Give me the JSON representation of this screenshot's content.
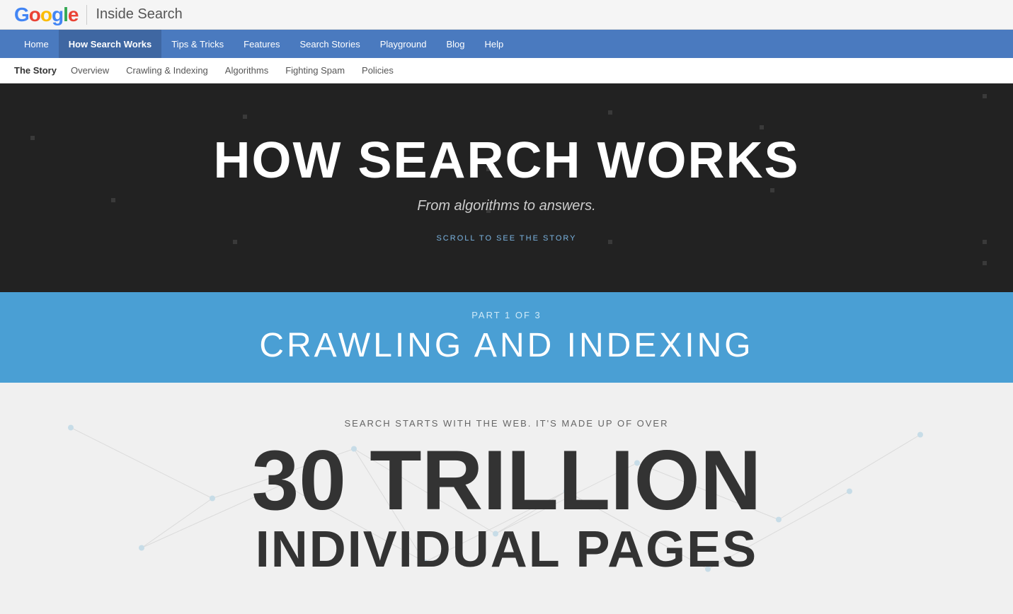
{
  "header": {
    "google_logo": "Google",
    "divider": "|",
    "site_title": "Inside Search"
  },
  "main_nav": {
    "items": [
      {
        "id": "home",
        "label": "Home",
        "active": false
      },
      {
        "id": "how-search-works",
        "label": "How Search Works",
        "active": true
      },
      {
        "id": "tips-tricks",
        "label": "Tips & Tricks",
        "active": false
      },
      {
        "id": "features",
        "label": "Features",
        "active": false
      },
      {
        "id": "search-stories",
        "label": "Search Stories",
        "active": false
      },
      {
        "id": "playground",
        "label": "Playground",
        "active": false
      },
      {
        "id": "blog",
        "label": "Blog",
        "active": false
      },
      {
        "id": "help",
        "label": "Help",
        "active": false
      }
    ]
  },
  "sub_nav": {
    "label": "The Story",
    "items": [
      {
        "id": "overview",
        "label": "Overview",
        "active": false
      },
      {
        "id": "crawling-indexing",
        "label": "Crawling & Indexing",
        "active": false
      },
      {
        "id": "algorithms",
        "label": "Algorithms",
        "active": false
      },
      {
        "id": "fighting-spam",
        "label": "Fighting Spam",
        "active": false
      },
      {
        "id": "policies",
        "label": "Policies",
        "active": false
      }
    ]
  },
  "hero": {
    "title": "HOW SEARCH WORKS",
    "subtitle": "From algorithms to answers.",
    "scroll_cta": "SCROLL TO SEE THE STORY"
  },
  "blue_section": {
    "part_label": "PART 1 OF 3",
    "part_title": "CRAWLING AND INDEXING"
  },
  "content_section": {
    "search_starts": "SEARCH STARTS WITH THE WEB. IT'S MADE UP OF OVER",
    "trillion": "30 TRILLION",
    "individual_pages": "INDIVIDUAL PAGES"
  }
}
